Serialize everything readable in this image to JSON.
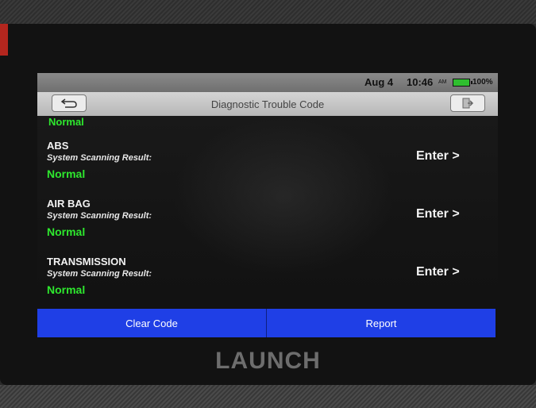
{
  "device": {
    "brand": "LAUNCH"
  },
  "status_bar": {
    "date": "Aug 4",
    "time": "10:46",
    "ampm": "AM",
    "battery": "100%"
  },
  "title_bar": {
    "title": "Diagnostic Trouble Code",
    "back_icon": "back-arrow-icon",
    "exit_icon": "exit-icon"
  },
  "partial_status": "Normal",
  "systems": [
    {
      "name": "ABS",
      "result_label": "System Scanning Result:",
      "status": "Normal",
      "action": "Enter >"
    },
    {
      "name": "AIR BAG",
      "result_label": "System Scanning Result:",
      "status": "Normal",
      "action": "Enter >"
    },
    {
      "name": "TRANSMISSION",
      "result_label": "System Scanning Result:",
      "status": "Normal",
      "action": "Enter >"
    }
  ],
  "buttons": {
    "clear_code": "Clear Code",
    "report": "Report"
  },
  "colors": {
    "status_normal": "#2ee82e",
    "button_blue": "#1f3fe6",
    "battery_green": "#2fbf2f"
  }
}
